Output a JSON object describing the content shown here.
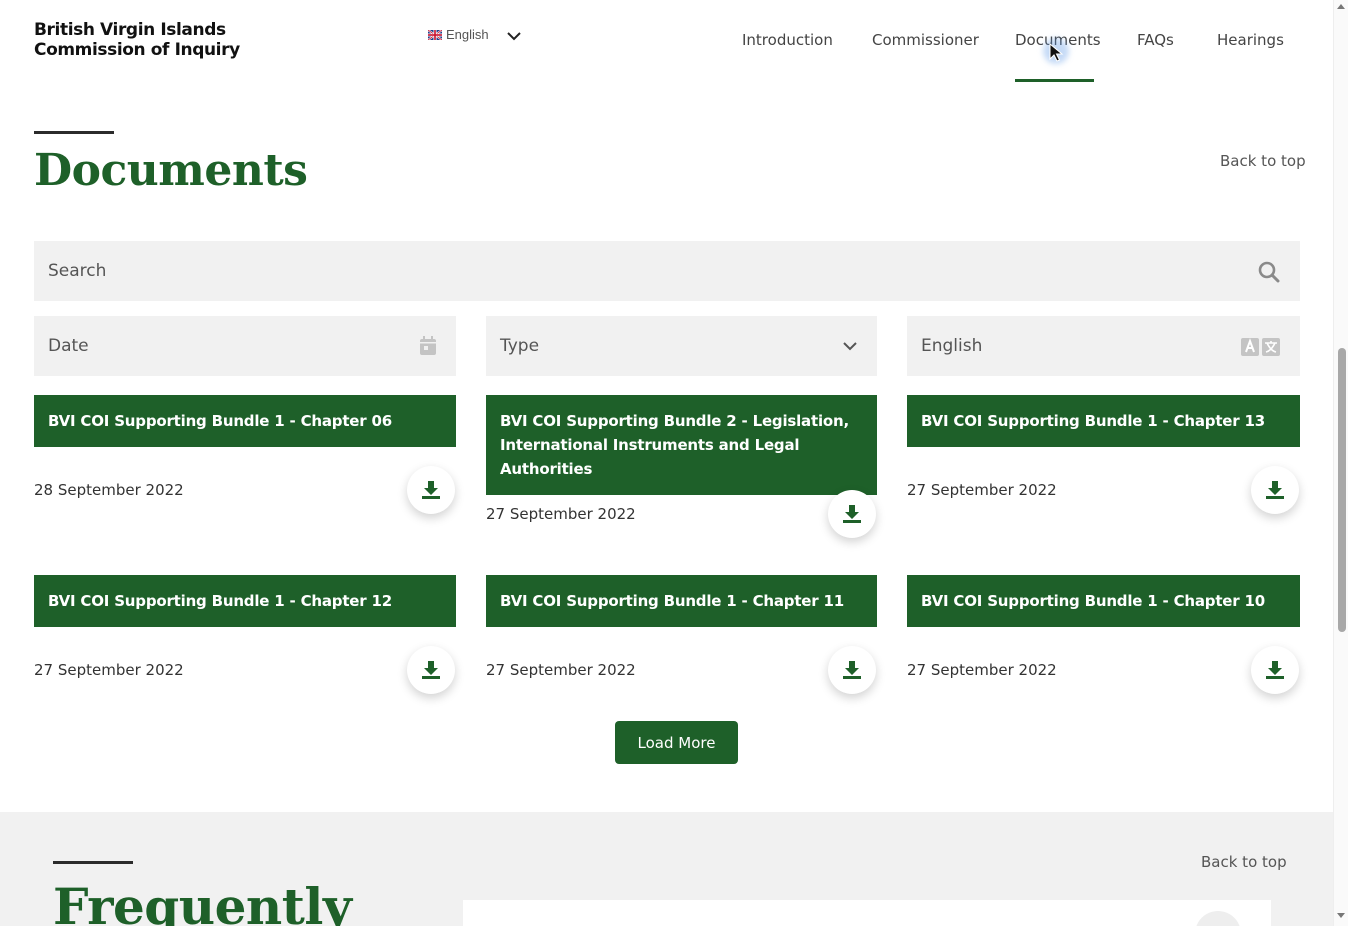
{
  "header": {
    "logo_line1": "British Virgin Islands",
    "logo_line2": "Commission of Inquiry",
    "language": "English",
    "nav": [
      {
        "label": "Introduction"
      },
      {
        "label": "Commissioner"
      },
      {
        "label": "Documents",
        "active": true
      },
      {
        "label": "FAQs"
      },
      {
        "label": "Hearings"
      }
    ]
  },
  "documents": {
    "title": "Documents",
    "back_to_top": "Back to top",
    "search_placeholder": "Search",
    "filters": {
      "date": "Date",
      "type": "Type",
      "language": "English"
    },
    "cards": [
      {
        "title": "BVI COI Supporting Bundle 1 - Chapter 06",
        "date": "28 September 2022"
      },
      {
        "title": "BVI COI Supporting Bundle 2 - Legislation, International Instruments and Legal Authorities",
        "date": "27 September 2022"
      },
      {
        "title": "BVI COI Supporting Bundle 1 - Chapter 13",
        "date": "27 September 2022"
      },
      {
        "title": "BVI COI Supporting Bundle 1 - Chapter 12",
        "date": "27 September 2022"
      },
      {
        "title": "BVI COI Supporting Bundle 1 - Chapter 11",
        "date": "27 September 2022"
      },
      {
        "title": "BVI COI Supporting Bundle 1 - Chapter 10",
        "date": "27 September 2022"
      }
    ],
    "load_more": "Load More"
  },
  "faq": {
    "title": "Frequently",
    "back_to_top": "Back to top"
  },
  "colors": {
    "brand_green": "#1e6029",
    "filter_bg": "#f1f1f1"
  }
}
